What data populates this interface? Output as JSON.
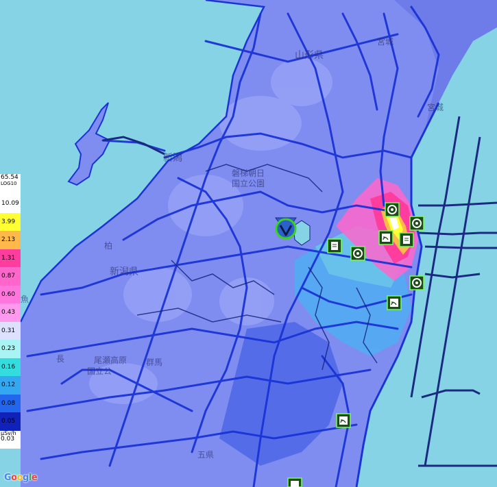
{
  "legend": {
    "max": "65.54",
    "scale": "LOG10",
    "items": [
      {
        "label": "10.09",
        "color": "#ffffff"
      },
      {
        "label": "3.99",
        "color": "#ffff33"
      },
      {
        "label": "2.13",
        "color": "#ffb84a"
      },
      {
        "label": "1.31",
        "color": "#ff3d9e"
      },
      {
        "label": "0.87",
        "color": "#ff66cc"
      },
      {
        "label": "0.60",
        "color": "#ff77dd"
      },
      {
        "label": "0.43",
        "color": "#ff99ee"
      },
      {
        "label": "0.31",
        "color": "#dde0ff"
      },
      {
        "label": "0.23",
        "color": "#a8f4f4"
      },
      {
        "label": "0.16",
        "color": "#33dddd"
      },
      {
        "label": "0.12",
        "color": "#33a8f0"
      },
      {
        "label": "0.08",
        "color": "#2266ee"
      },
      {
        "label": "0.05",
        "color": "#1122bb"
      }
    ],
    "unit": "µSv/h",
    "min": "0.03"
  },
  "places": {
    "yamagata": "山形県",
    "miyagi": "宮城",
    "miyagi_ken": "宮城",
    "niigata": "新潟",
    "bandai": "磐梯朝日",
    "park": "国立公園",
    "kashiwazaki": "柏",
    "niigata_ken": "新潟県",
    "uonuma": "魚",
    "gunma": "群馬",
    "oze": "尾瀬高原",
    "nagano": "長",
    "national": "国立公",
    "tochigi": "五県"
  },
  "brand": {
    "logo": "Google"
  },
  "colors": {
    "sea": "#86d3e6",
    "land": "#7f8cf0",
    "roads": "#1a33d6",
    "hot": "#ff3d9e"
  }
}
